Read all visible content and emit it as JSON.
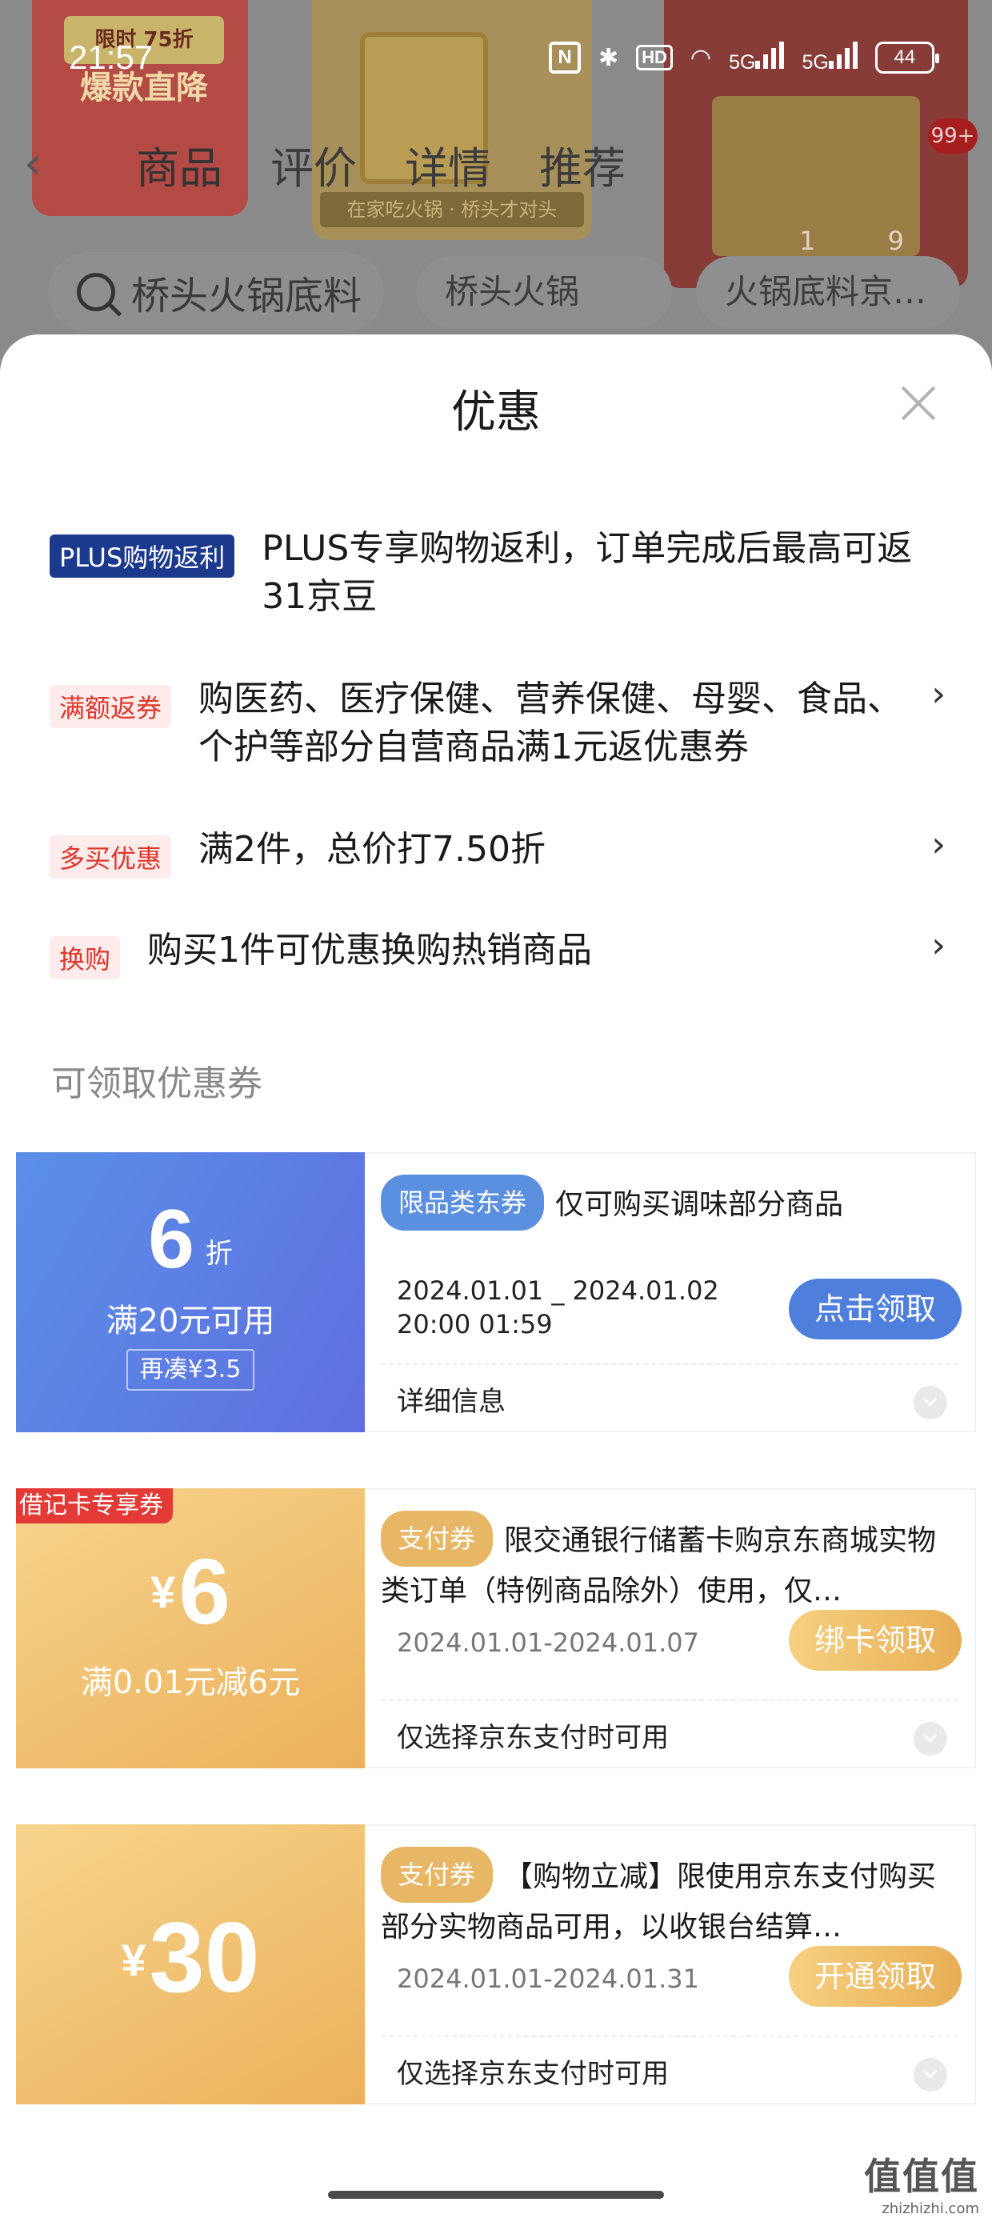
{
  "status_bar": {
    "time": "21:57",
    "nfc": "N",
    "hd": "HD",
    "net1": "5G",
    "net2": "5G",
    "battery": "44"
  },
  "background": {
    "promo_top": "限时 75折",
    "promo_main": "爆款直降",
    "product_caption": "在家吃火锅 · 桥头才对头",
    "tabs": [
      "商品",
      "评价",
      "详情",
      "推荐"
    ],
    "search_placeholder": "桥头火锅底料",
    "chips": [
      "桥头火锅底…",
      "火锅底料京…"
    ],
    "cart_badge": "99+",
    "pager": "1 9"
  },
  "sheet": {
    "title": "优惠",
    "promotions": [
      {
        "tag": "PLUS购物返利",
        "text": "PLUS专享购物返利，订单完成后最高可返31京豆"
      },
      {
        "tag": "满额返券",
        "text": "购医药、医疗保健、营养保健、母婴、食品、个护等部分自营商品满1元返优惠券",
        "chevron": "›"
      },
      {
        "tag": "多买优惠",
        "text": "满2件，总价打7.50折",
        "chevron": "›"
      },
      {
        "tag": "换购",
        "text": "购买1件可优惠换购热销商品",
        "chevron": "›"
      }
    ],
    "coupons_label": "可领取优惠券",
    "coupons": [
      {
        "value": "6",
        "unit": "折",
        "condition": "满20元可用",
        "extra": "再凑¥3.5",
        "type": "限品类东券",
        "desc": "仅可购买调味部分商品",
        "date_line1": "2024.01.01 _ 2024.01.02",
        "date_line2": "20:00 01:59",
        "button": "点击领取",
        "footer": "详细信息"
      },
      {
        "badge": "借记卡专享券",
        "symbol": "¥",
        "value": "6",
        "condition": "满0.01元减6元",
        "type": "支付券",
        "desc": "限交通银行储蓄卡购京东商城实物类订单（特例商品除外）使用，仅…",
        "date": "2024.01.01-2024.01.07",
        "button": "绑卡领取",
        "footer": "仅选择京东支付时可用"
      },
      {
        "symbol": "¥",
        "value": "30",
        "type": "支付券",
        "desc": "【购物立减】限使用京东支付购买部分实物商品可用，以收银台结算…",
        "date": "2024.01.01-2024.01.31",
        "button": "开通领取",
        "footer": "仅选择京东支付时可用"
      }
    ]
  },
  "watermark": {
    "big": "值值值",
    "small": "zhizhizhi.com"
  },
  "colors": {
    "plus_tag": "#1b3a8e",
    "promo_tag_text": "#e0352a",
    "coupon_blue": "#5a8fe8",
    "coupon_gold": "#ebb05a"
  }
}
